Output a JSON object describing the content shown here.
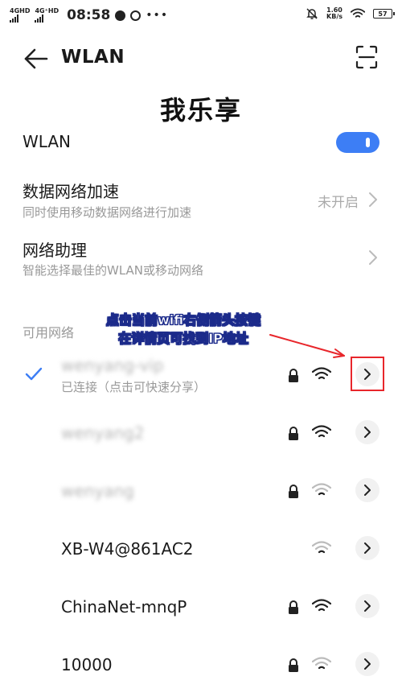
{
  "status_bar": {
    "net1": "4GHD",
    "net2": "4G⁺HD",
    "time": "08:58",
    "speed_value": "1.60",
    "speed_unit": "KB/s",
    "battery": "57"
  },
  "header": {
    "title": "WLAN",
    "back_icon": "arrow-left-icon",
    "scan_icon": "scan-icon"
  },
  "watermark": "我乐享",
  "wlan_toggle": {
    "label": "WLAN",
    "state": "on",
    "accent": "#3d7ef5"
  },
  "settings": [
    {
      "title": "数据网络加速",
      "subtitle": "同时使用移动数据网络进行加速",
      "value": "未开启"
    },
    {
      "title": "网络助理",
      "subtitle": "智能选择最佳的WLAN或移动网络",
      "value": ""
    }
  ],
  "networks_section": {
    "label": "可用网络",
    "items": [
      {
        "name": "wenyang-vip",
        "status": "已连接（点击可快速分享）",
        "connected": true,
        "locked": true,
        "signal": "strong",
        "blurred": true
      },
      {
        "name": "wenyang2",
        "status": "",
        "connected": false,
        "locked": true,
        "signal": "strong",
        "blurred": true
      },
      {
        "name": "wenyang",
        "status": "",
        "connected": false,
        "locked": true,
        "signal": "weak",
        "blurred": true
      },
      {
        "name": "XB-W4@861AC2",
        "status": "",
        "connected": false,
        "locked": false,
        "signal": "weak",
        "blurred": false
      },
      {
        "name": "ChinaNet-mnqP",
        "status": "",
        "connected": false,
        "locked": true,
        "signal": "strong",
        "blurred": false
      },
      {
        "name": "10000",
        "status": "",
        "connected": false,
        "locked": true,
        "signal": "weak",
        "blurred": false
      }
    ]
  },
  "annotation": {
    "line1": "点击当前wifi右侧箭头按键",
    "line2": "在详情页可找到IP地址",
    "color": "#e8262b"
  }
}
